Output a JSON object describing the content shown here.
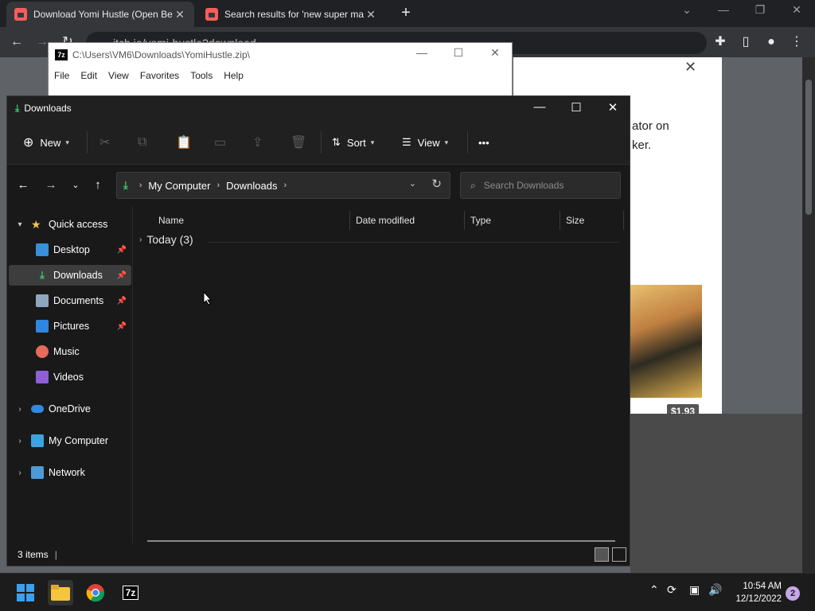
{
  "browser": {
    "tabs": [
      {
        "title": "Download Yomi Hustle (Open Be"
      },
      {
        "title": "Search results for 'new super ma"
      }
    ],
    "new_tab_label": "+",
    "url": "itch.io/yomi-hustle?download",
    "page": {
      "text_line1": "ator on",
      "text_line2": "ker.",
      "price": "$1.93"
    }
  },
  "sevenzip": {
    "logo": "7z",
    "title": "C:\\Users\\VM6\\Downloads\\YomiHustle.zip\\",
    "menu": [
      "File",
      "Edit",
      "View",
      "Favorites",
      "Tools",
      "Help"
    ]
  },
  "explorer": {
    "title": "Downloads",
    "command_bar": {
      "new_label": "New",
      "sort_label": "Sort",
      "view_label": "View",
      "more_label": "•••"
    },
    "address": {
      "segments": [
        "My Computer",
        "Downloads"
      ]
    },
    "search": {
      "placeholder": "Search Downloads"
    },
    "nav": {
      "quick_access": "Quick access",
      "items": [
        {
          "label": "Desktop",
          "icon": "desktop-icon",
          "pinned": true
        },
        {
          "label": "Downloads",
          "icon": "download-icon",
          "pinned": true
        },
        {
          "label": "Documents",
          "icon": "documents-icon",
          "pinned": true
        },
        {
          "label": "Pictures",
          "icon": "pictures-icon",
          "pinned": true
        },
        {
          "label": "Music",
          "icon": "music-icon",
          "pinned": false
        },
        {
          "label": "Videos",
          "icon": "videos-icon",
          "pinned": false
        }
      ],
      "onedrive": "OneDrive",
      "my_computer": "My Computer",
      "network": "Network"
    },
    "columns": [
      "Name",
      "Date modified",
      "Type",
      "Size"
    ],
    "groups": [
      {
        "label": "Today (3)"
      }
    ],
    "status": "3 items"
  },
  "taskbar": {
    "time": "10:54 AM",
    "date": "12/12/2022",
    "notifications": "2",
    "sevenzip_label": "7z"
  },
  "colors": {
    "accent_green": "#3cc86a",
    "itch_red": "#fa5c5c",
    "dark_bg": "#191919"
  }
}
